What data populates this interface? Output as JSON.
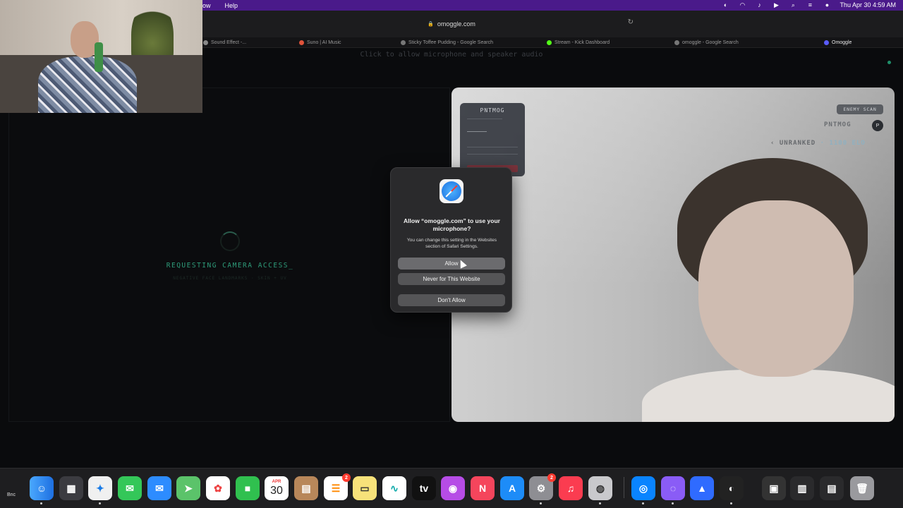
{
  "menubar": {
    "menus": [
      "ow",
      "Help"
    ],
    "datetime": "Thu Apr 30  4:59 AM"
  },
  "browser": {
    "address": "omoggle.com",
    "tabs": [
      {
        "label": "Sound Effect -...",
        "color": "#888888"
      },
      {
        "label": "Suno | AI Music",
        "color": "#e0533a"
      },
      {
        "label": "Sticky Toffee Pudding - Google Search",
        "color": "#777777"
      },
      {
        "label": "Stream - Kick Dashboard",
        "color": "#53fc18"
      },
      {
        "label": "omoggle - Google Search",
        "color": "#777777"
      },
      {
        "label": "Omoggle",
        "color": "#5a5cff"
      }
    ]
  },
  "page": {
    "hint": "Click to allow microphone and speaker audio",
    "requesting": "REQUESTING CAMERA ACCESS_",
    "requesting_sub": "NEGATIVE FACE LANDMARKS · SKIN + UV",
    "scan_card_title": "PNTMOG",
    "enemy_chip": "ENEMY SCAN",
    "opponent_name": "PNTMOG",
    "opponent_avatar": "P",
    "rank": "‹ UNRANKED",
    "rank_suffix": "· 1100 ELO"
  },
  "dialog": {
    "title": "Allow “omoggle.com” to use your microphone?",
    "body": "You can change this setting in the Websites section of Safari Settings.",
    "allow": "Allow",
    "never": "Never for This Website",
    "deny": "Don't Allow"
  },
  "dock": {
    "label": "Bnc",
    "calendar_month": "APR",
    "calendar_day": "30",
    "reminders_badge": "2",
    "settings_badge": "2",
    "tv_label": "tv"
  }
}
